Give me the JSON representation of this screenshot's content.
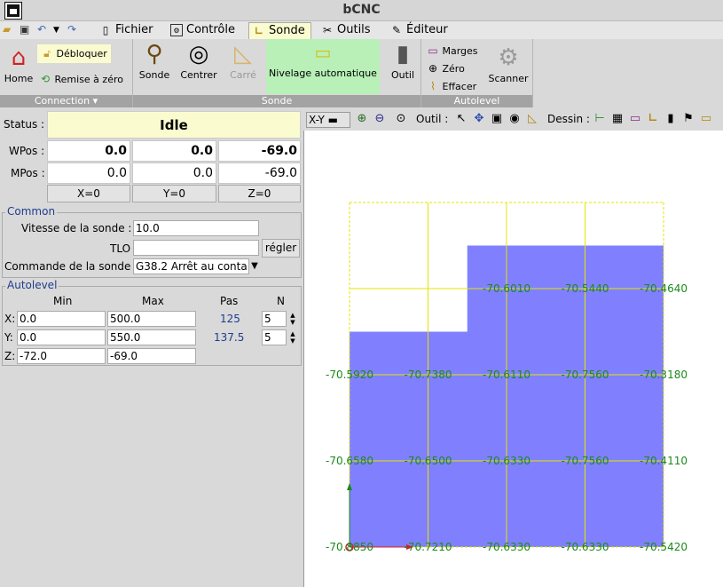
{
  "window": {
    "title": "bCNC"
  },
  "menu": {
    "tabs": [
      {
        "label": "Fichier",
        "icon": "file-icon"
      },
      {
        "label": "Contrôle",
        "icon": "control-icon"
      },
      {
        "label": "Sonde",
        "icon": "probe-icon",
        "active": true
      },
      {
        "label": "Outils",
        "icon": "tools-icon"
      },
      {
        "label": "Éditeur",
        "icon": "editor-icon"
      }
    ]
  },
  "ribbon": {
    "connection": {
      "label": "Connection",
      "home": "Home",
      "unlock": "Débloquer",
      "reset": "Remise à zéro"
    },
    "sonde": {
      "label": "Sonde",
      "probe": "Sonde",
      "center": "Centrer",
      "square": "Carré",
      "autolevel": "Nivelage automatique",
      "tool": "Outil"
    },
    "autolevel": {
      "label": "Autolevel",
      "margins": "Marges",
      "zero": "Zéro",
      "clear": "Effacer",
      "scan": "Scanner"
    }
  },
  "state": {
    "status_label": "Status :",
    "status": "Idle",
    "wpos_label": "WPos :",
    "mpos_label": "MPos :",
    "wpos": [
      "0.0",
      "0.0",
      "-69.0"
    ],
    "mpos": [
      "0.0",
      "0.0",
      "-69.0"
    ],
    "zero_buttons": [
      "X=0",
      "Y=0",
      "Z=0"
    ]
  },
  "common": {
    "legend": "Common",
    "probe_speed_label": "Vitesse de la sonde :",
    "probe_speed": "10.0",
    "tlo_label": "TLO",
    "tlo": "",
    "set_button": "régler",
    "probe_cmd_label": "Commande de la sonde",
    "probe_cmd": "G38.2 Arrêt au conta"
  },
  "autolevel_panel": {
    "legend": "Autolevel",
    "headers": [
      "Min",
      "Max",
      "Pas",
      "N"
    ],
    "rows": [
      {
        "axis": "X:",
        "min": "0.0",
        "max": "500.0",
        "step": "125",
        "n": "5"
      },
      {
        "axis": "Y:",
        "min": "0.0",
        "max": "550.0",
        "step": "137.5",
        "n": "5"
      },
      {
        "axis": "Z:",
        "min": "-72.0",
        "max": "-69.0",
        "step": "",
        "n": ""
      }
    ]
  },
  "canvas_toolbar": {
    "view": "X-Y",
    "tool_label": "Outil :",
    "draw_label": "Dessin :"
  },
  "probe_grid": {
    "columns": 5,
    "rows": 5,
    "labels": [
      [
        "-70.8850",
        "-70.7210",
        "-70.6330",
        "-70.6330",
        "-70.5420"
      ],
      [
        "-70.6580",
        "-70.6500",
        "-70.6330",
        "-70.7560",
        "-70.4110"
      ],
      [
        "-70.5920",
        "-70.7380",
        "-70.6110",
        "-70.7560",
        "-70.3180"
      ],
      [
        "",
        "",
        "-70.6010",
        "-70.5440",
        "-70.4640"
      ],
      [
        "",
        "",
        "",
        "",
        ""
      ]
    ],
    "colors": {
      "fill": "#8080ff",
      "grid": "#e5e500",
      "labels": "#1a8a1a"
    }
  }
}
